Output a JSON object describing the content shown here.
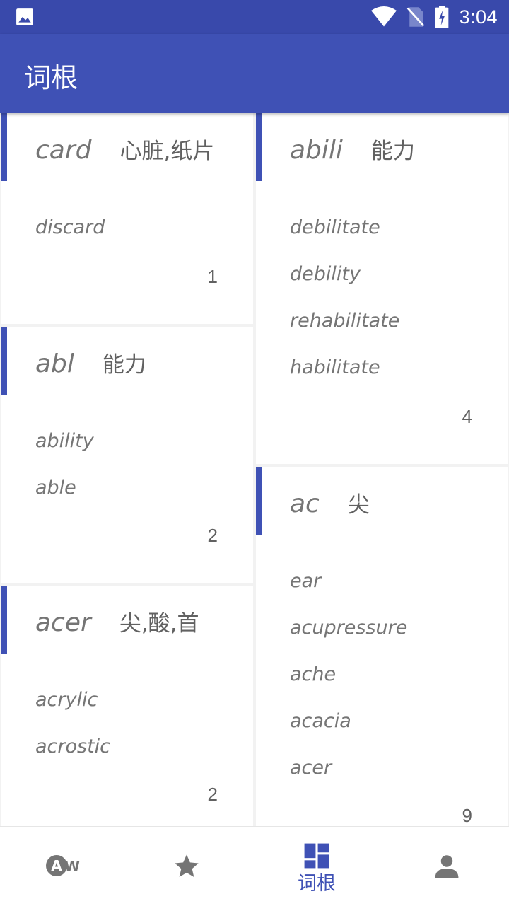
{
  "status_bar": {
    "time": "3:04",
    "icons": [
      "image-icon",
      "wifi-icon",
      "no-sim-icon",
      "battery-charging-icon"
    ]
  },
  "app_bar": {
    "title": "词根"
  },
  "cards": [
    {
      "root": "card",
      "meaning": "心脏,纸片",
      "words": [
        "discard"
      ],
      "count": "1"
    },
    {
      "root": "abl",
      "meaning": "能力",
      "words": [
        "ability",
        "able"
      ],
      "count": "2"
    },
    {
      "root": "acer",
      "meaning": "尖,酸,首",
      "words": [
        "acrylic",
        "acrostic"
      ],
      "count": "2"
    },
    {
      "root": "abili",
      "meaning": "能力",
      "words": [
        "debilitate",
        "debility",
        "rehabilitate",
        "habilitate"
      ],
      "count": "4"
    },
    {
      "root": "ac",
      "meaning": "尖",
      "words": [
        "ear",
        "acupressure",
        "ache",
        "acacia",
        "acer"
      ],
      "count": "9"
    }
  ],
  "bottom_nav": {
    "items": [
      {
        "name": "words-tab",
        "icon": "aw-icon",
        "label": ""
      },
      {
        "name": "favorites-tab",
        "icon": "star-icon",
        "label": ""
      },
      {
        "name": "roots-tab",
        "icon": "dashboard-icon",
        "label": "词根",
        "active": true
      },
      {
        "name": "profile-tab",
        "icon": "person-icon",
        "label": ""
      }
    ]
  },
  "colors": {
    "primary": "#3f51b5",
    "status_bar": "#3949ab",
    "text_gray": "#757575"
  }
}
